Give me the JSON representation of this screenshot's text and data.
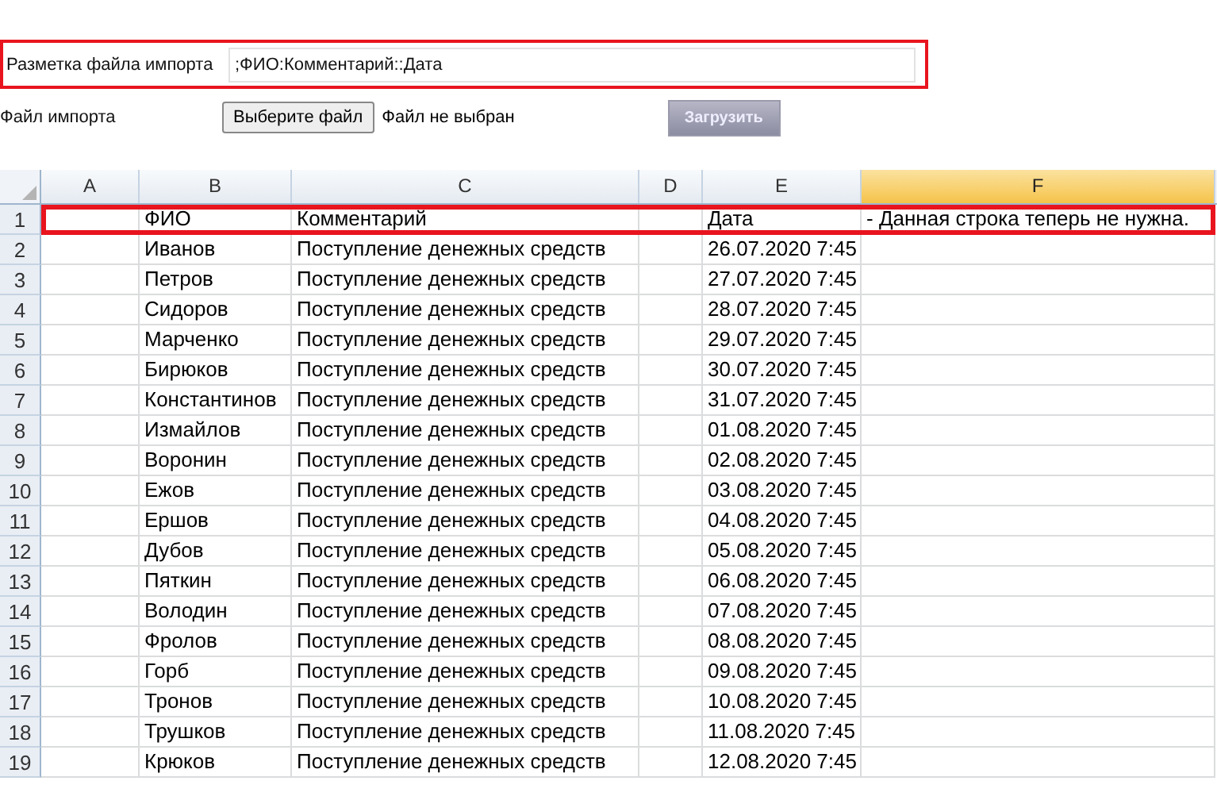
{
  "form": {
    "markup": {
      "label": "Разметка файла импорта",
      "value": ";ФИО:Комментарий::Дата",
      "highlighted": true
    },
    "file": {
      "label": "Файл импорта",
      "button": "Выберите файл",
      "status": "Файл не выбран"
    },
    "upload_button": {
      "label": "Загрузить",
      "disabled": true
    }
  },
  "sheet": {
    "columns": [
      {
        "label": "A",
        "selected": false
      },
      {
        "label": "B",
        "selected": false
      },
      {
        "label": "C",
        "selected": false
      },
      {
        "label": "D",
        "selected": false
      },
      {
        "label": "E",
        "selected": false
      },
      {
        "label": "F",
        "selected": true
      }
    ],
    "rows": [
      {
        "number": "1",
        "highlighted": true,
        "cells": [
          "",
          "ФИО",
          "Комментарий",
          "",
          "Дата",
          "- Данная строка теперь не нужна."
        ]
      },
      {
        "number": "2",
        "highlighted": false,
        "cells": [
          "",
          "Иванов",
          "Поступление денежных средств",
          "",
          "26.07.2020 7:45",
          ""
        ]
      },
      {
        "number": "3",
        "highlighted": false,
        "cells": [
          "",
          "Петров",
          "Поступление денежных средств",
          "",
          "27.07.2020 7:45",
          ""
        ]
      },
      {
        "number": "4",
        "highlighted": false,
        "cells": [
          "",
          "Сидоров",
          "Поступление денежных средств",
          "",
          "28.07.2020 7:45",
          ""
        ]
      },
      {
        "number": "5",
        "highlighted": false,
        "cells": [
          "",
          "Марченко",
          "Поступление денежных средств",
          "",
          "29.07.2020 7:45",
          ""
        ]
      },
      {
        "number": "6",
        "highlighted": false,
        "cells": [
          "",
          "Бирюков",
          "Поступление денежных средств",
          "",
          "30.07.2020 7:45",
          ""
        ]
      },
      {
        "number": "7",
        "highlighted": false,
        "cells": [
          "",
          "Константинов",
          "Поступление денежных средств",
          "",
          "31.07.2020 7:45",
          ""
        ]
      },
      {
        "number": "8",
        "highlighted": false,
        "cells": [
          "",
          "Измайлов",
          "Поступление денежных средств",
          "",
          "01.08.2020 7:45",
          ""
        ]
      },
      {
        "number": "9",
        "highlighted": false,
        "cells": [
          "",
          "Воронин",
          "Поступление денежных средств",
          "",
          "02.08.2020 7:45",
          ""
        ]
      },
      {
        "number": "10",
        "highlighted": false,
        "cells": [
          "",
          "Ежов",
          "Поступление денежных средств",
          "",
          "03.08.2020 7:45",
          ""
        ]
      },
      {
        "number": "11",
        "highlighted": false,
        "cells": [
          "",
          "Ершов",
          "Поступление денежных средств",
          "",
          "04.08.2020 7:45",
          ""
        ]
      },
      {
        "number": "12",
        "highlighted": false,
        "cells": [
          "",
          "Дубов",
          "Поступление денежных средств",
          "",
          "05.08.2020 7:45",
          ""
        ]
      },
      {
        "number": "13",
        "highlighted": false,
        "cells": [
          "",
          "Пяткин",
          "Поступление денежных средств",
          "",
          "06.08.2020 7:45",
          ""
        ]
      },
      {
        "number": "14",
        "highlighted": false,
        "cells": [
          "",
          "Володин",
          "Поступление денежных средств",
          "",
          "07.08.2020 7:45",
          ""
        ]
      },
      {
        "number": "15",
        "highlighted": false,
        "cells": [
          "",
          "Фролов",
          "Поступление денежных средств",
          "",
          "08.08.2020 7:45",
          ""
        ]
      },
      {
        "number": "16",
        "highlighted": false,
        "cells": [
          "",
          "Горб",
          "Поступление денежных средств",
          "",
          "09.08.2020 7:45",
          ""
        ]
      },
      {
        "number": "17",
        "highlighted": false,
        "cells": [
          "",
          "Тронов",
          "Поступление денежных средств",
          "",
          "10.08.2020 7:45",
          ""
        ]
      },
      {
        "number": "18",
        "highlighted": false,
        "cells": [
          "",
          "Трушков",
          "Поступление денежных средств",
          "",
          "11.08.2020 7:45",
          ""
        ]
      },
      {
        "number": "19",
        "highlighted": false,
        "cells": [
          "",
          "Крюков",
          "Поступление денежных средств",
          "",
          "12.08.2020 7:45",
          ""
        ]
      }
    ]
  }
}
